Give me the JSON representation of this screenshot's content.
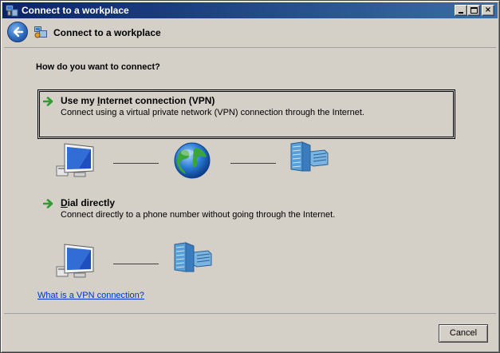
{
  "window": {
    "title": "Connect to a workplace",
    "controls": {
      "minimize": "_",
      "maximize": "□",
      "close": "×"
    }
  },
  "header": {
    "title": "Connect to a workplace",
    "back_icon": "back-arrow-icon",
    "wizard_icon": "network-wizard-icon"
  },
  "content": {
    "question": "How do you want to connect?",
    "options": [
      {
        "title_pre": "Use my ",
        "title_accel": "I",
        "title_post": "nternet connection (VPN)",
        "description": "Connect using a virtual private network (VPN) connection through the Internet.",
        "selected": true,
        "diagram": [
          "computer-icon",
          "globe-icon",
          "server-icon"
        ]
      },
      {
        "title_pre": "",
        "title_accel": "D",
        "title_post": "ial directly",
        "description": "Connect directly to a phone number without going through the Internet.",
        "selected": false,
        "diagram": [
          "computer-icon",
          "server-icon"
        ]
      }
    ],
    "help_link": "What is a VPN connection?"
  },
  "footer": {
    "cancel_label": "Cancel"
  },
  "colors": {
    "titlebar_start": "#0a246a",
    "titlebar_end": "#3a6ea5",
    "face": "#d4d0c8",
    "link": "#0033cc",
    "arrow_green": "#2e9d2e"
  }
}
